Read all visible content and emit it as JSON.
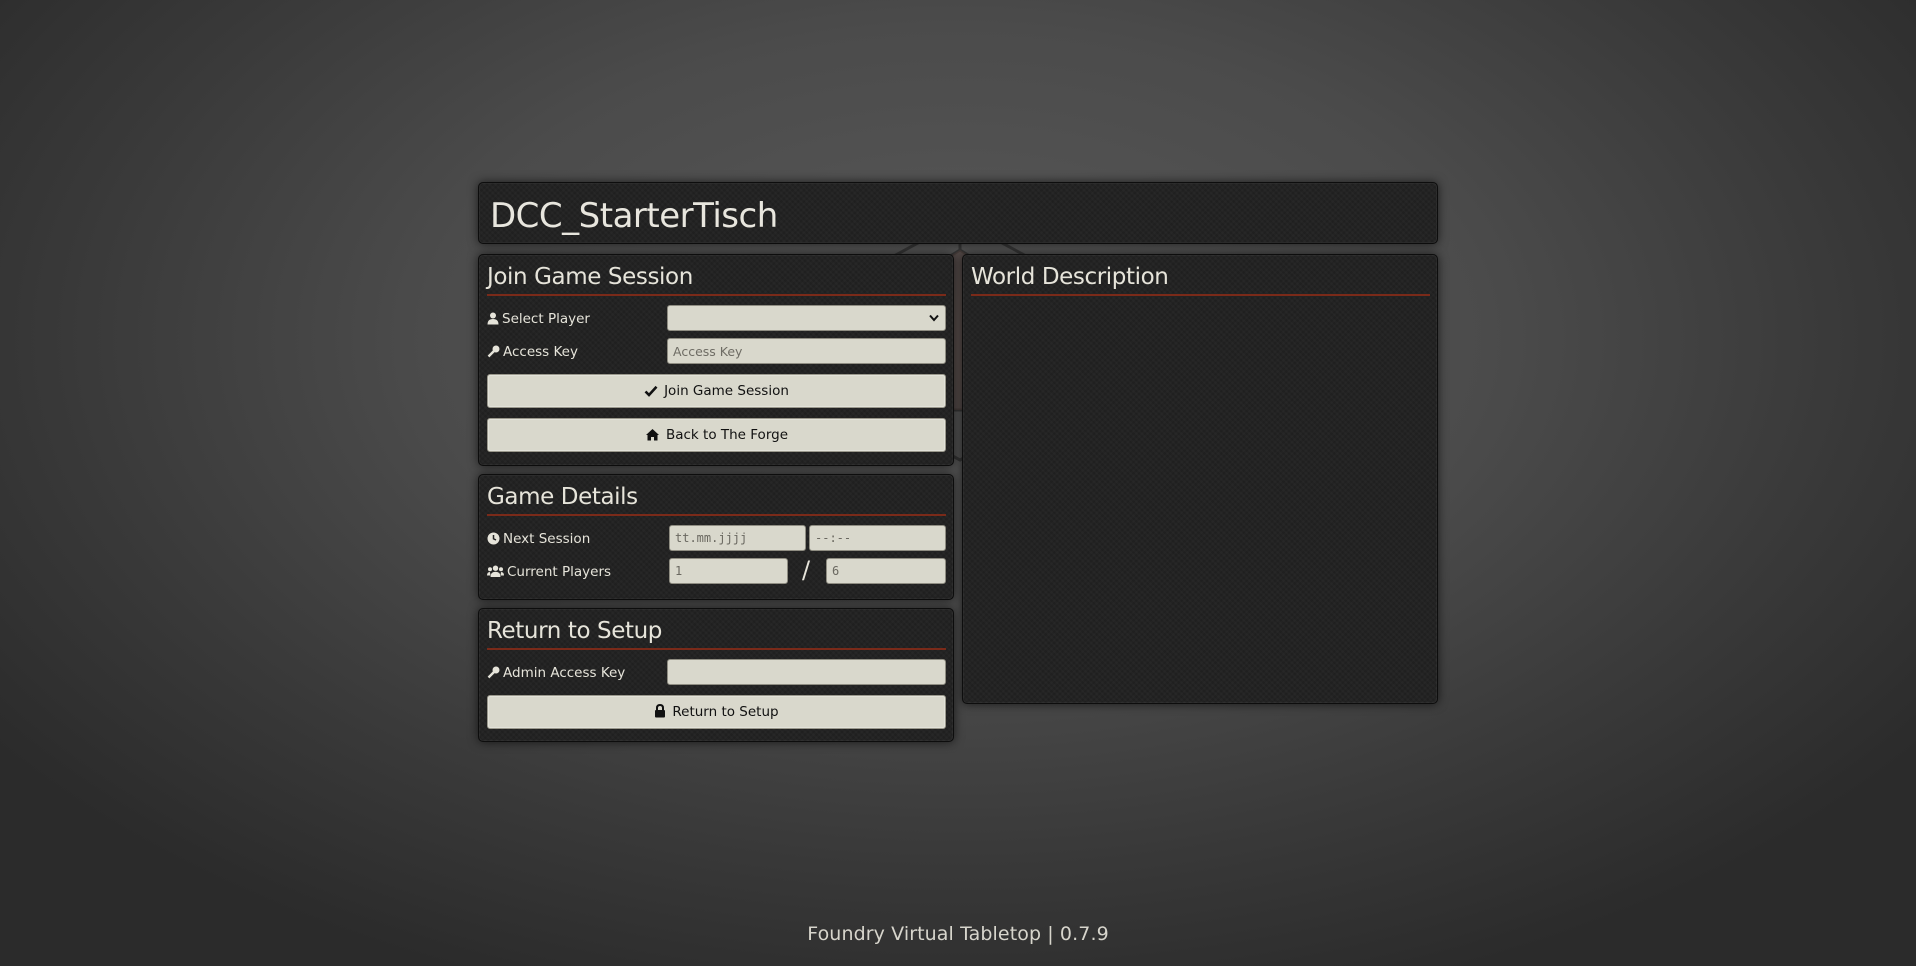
{
  "world": {
    "title": "DCC_StarterTisch"
  },
  "join": {
    "heading": "Join Game Session",
    "select_player_label": "Select Player",
    "select_player_value": "",
    "access_key_label": "Access Key",
    "access_key_placeholder": "Access Key",
    "join_button": "Join Game Session",
    "back_button": "Back to The Forge"
  },
  "details": {
    "heading": "Game Details",
    "next_session_label": "Next Session",
    "date_placeholder": "tt.mm.jjjj",
    "time_placeholder": "--:--",
    "current_players_label": "Current Players",
    "current_players": "1",
    "max_players": "6",
    "separator": "/"
  },
  "setup": {
    "heading": "Return to Setup",
    "admin_key_label": "Admin Access Key",
    "admin_key_value": "",
    "return_button": "Return to Setup"
  },
  "description": {
    "heading": "World Description"
  },
  "footer": {
    "text": "Foundry Virtual Tabletop | 0.7.9"
  },
  "colors": {
    "accent_rule": "#7a2a19",
    "panel_bg": "#232323",
    "button_bg": "#d9d8cc"
  },
  "icons": {
    "select_player": "user-icon",
    "access_key": "key-icon",
    "join": "check-icon",
    "back": "home-icon",
    "next_session": "clock-icon",
    "current_players": "users-icon",
    "admin_key": "key-icon",
    "return": "lock-icon"
  }
}
